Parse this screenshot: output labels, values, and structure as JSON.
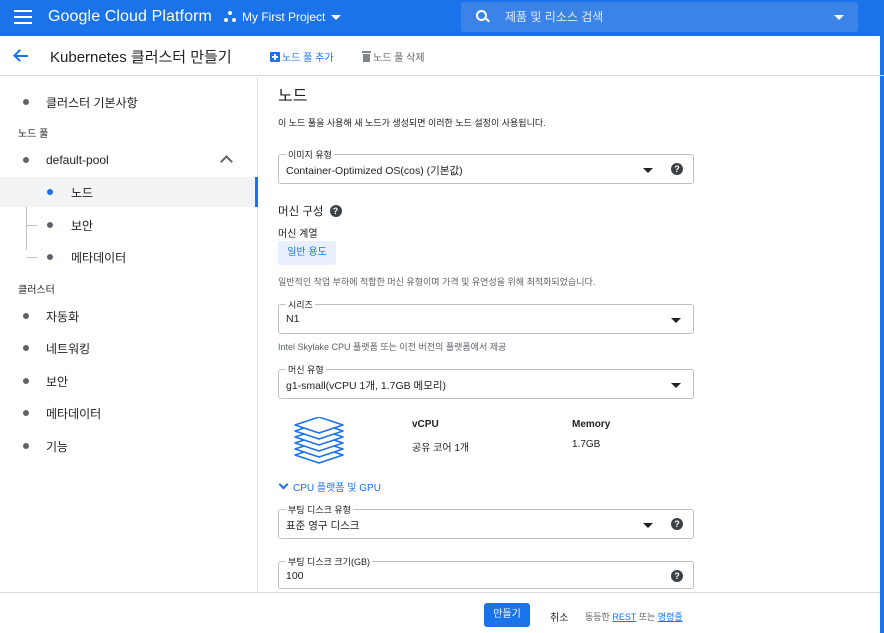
{
  "header": {
    "brand": "Google Cloud Platform",
    "project": "My First Project",
    "search_placeholder": "제품 및 리소스 검색"
  },
  "subbar": {
    "title": "Kubernetes 클러스터 만들기",
    "add_pool": "노드 풀 추가",
    "delete_pool": "노드 풀 삭제"
  },
  "sidebar": {
    "cluster_basics": "클러스터 기본사항",
    "section_node_pools": "노드 풀",
    "pool_name": "default-pool",
    "pool_children": [
      "노드",
      "보안",
      "메타데이터"
    ],
    "section_cluster": "클러스터",
    "cluster_items": [
      "자동화",
      "네트워킹",
      "보안",
      "메타데이터",
      "기능"
    ]
  },
  "main": {
    "title": "노드",
    "intro": "이 노드 풀을 사용해 새 노드가 생성되면 이러한 노드 설정이 사용됩니다.",
    "image_type": {
      "label": "이미지 유형",
      "value": "Container-Optimized OS(cos) (기본값)"
    },
    "machine_config": "머신 구성",
    "machine_family": "머신 계열",
    "family_chip": "일반 용도",
    "family_desc": "일반적인 작업 부하에 적합한 머신 유형이며 가격 및 유연성을 위해 최적화되었습니다.",
    "series": {
      "label": "시리즈",
      "value": "N1"
    },
    "series_desc": "Intel Skylake CPU 플랫폼 또는 이전 버전의 플랫폼에서 제공",
    "machine_type": {
      "label": "머신 유형",
      "value": "g1-small(vCPU 1개, 1.7GB 메모리)"
    },
    "specs": {
      "vcpu_label": "vCPU",
      "vcpu_value": "공유 코어 1개",
      "memory_label": "Memory",
      "memory_value": "1.7GB"
    },
    "cpu_platform_link": "CPU 플랫폼 및 GPU",
    "boot_disk_type": {
      "label": "부팅 디스크 유형",
      "value": "표준 영구 디스크"
    },
    "boot_disk_size": {
      "label": "부팅 디스크 크기(GB)",
      "value": "100"
    }
  },
  "footer": {
    "create": "만들기",
    "cancel": "취소",
    "equiv_prefix": "동등한",
    "rest": "REST",
    "or": "또는",
    "cmdline": "명령줄"
  },
  "colors": {
    "accent": "#1a73e8",
    "chip_bg": "#e8f0fe"
  }
}
